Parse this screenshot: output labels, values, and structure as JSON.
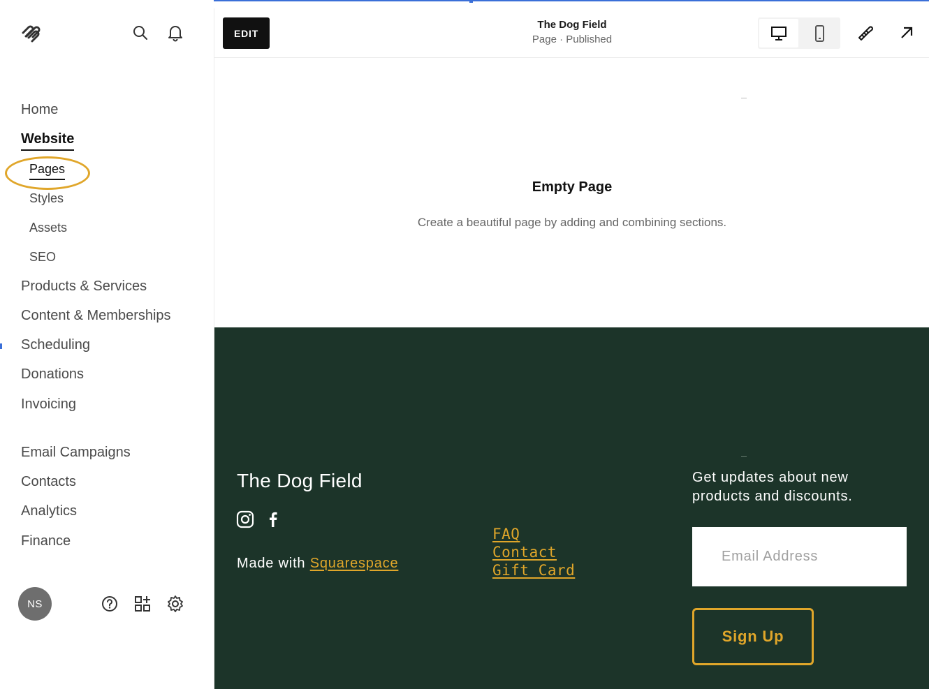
{
  "sidebar": {
    "logo_icon": "squarespace-logo-icon",
    "top_icons": [
      "search-icon",
      "bell-icon"
    ],
    "items": [
      {
        "label": "Home"
      },
      {
        "label": "Website"
      },
      {
        "label": "Pages"
      },
      {
        "label": "Styles"
      },
      {
        "label": "Assets"
      },
      {
        "label": "SEO"
      },
      {
        "label": "Products & Services"
      },
      {
        "label": "Content & Memberships"
      },
      {
        "label": "Scheduling"
      },
      {
        "label": "Donations"
      },
      {
        "label": "Invoicing"
      },
      {
        "label": "Email Campaigns"
      },
      {
        "label": "Contacts"
      },
      {
        "label": "Analytics"
      },
      {
        "label": "Finance"
      }
    ],
    "avatar_initials": "NS",
    "bottom_icons": [
      "help-icon",
      "apps-icon",
      "settings-icon"
    ],
    "highlight_color": "#e0a62a"
  },
  "toolbar": {
    "edit_label": "EDIT",
    "page_title": "The Dog Field",
    "page_status": "Page · Published",
    "device_icons": [
      "desktop-icon",
      "mobile-icon"
    ],
    "tool_icons": [
      "design-brush-icon",
      "open-external-icon"
    ]
  },
  "canvas": {
    "empty_title": "Empty Page",
    "empty_description": "Create a beautiful page by adding and combining sections."
  },
  "footer": {
    "background": "#1c3429",
    "accent": "#e0a62a",
    "site_name": "The Dog Field",
    "social_icons": [
      "instagram-icon",
      "facebook-icon"
    ],
    "made_with_prefix": "Made with",
    "made_with_link": "Squarespace",
    "links": [
      {
        "label": "FAQ"
      },
      {
        "label": "Contact"
      },
      {
        "label": "Gift Card"
      }
    ],
    "newsletter_text": "Get updates about new products and discounts.",
    "email_placeholder": "Email Address",
    "signup_label": "Sign Up"
  }
}
